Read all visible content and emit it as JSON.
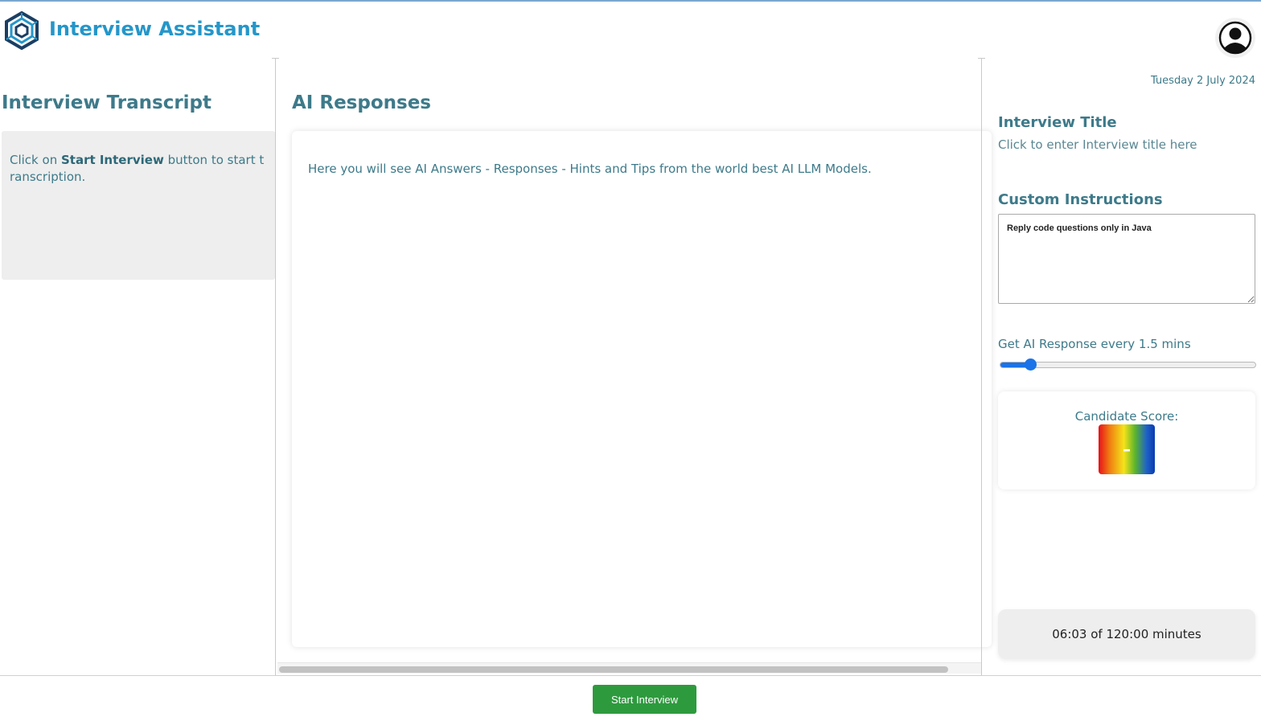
{
  "app": {
    "title": "Interview Assistant"
  },
  "transcript": {
    "heading": "Interview Transcript",
    "text_before": "Click on ",
    "text_bold": "Start Interview",
    "text_after": " button to start transcription."
  },
  "responses": {
    "heading": "AI Responses",
    "placeholder_text": "Here you will see AI Answers - Responses - Hints and Tips from the world best AI LLM Models."
  },
  "sidebar": {
    "date": "Tuesday 2 July 2024",
    "interview_title_heading": "Interview Title",
    "interview_title_placeholder": "Click to enter Interview title here",
    "custom_instructions_heading": "Custom Instructions",
    "custom_instructions_value": "Reply code questions only in Java",
    "slider_label": "Get AI Response every 1.5 mins",
    "slider_fraction": 0.12,
    "score_label": "Candidate Score:",
    "score_value": "–",
    "timer_text": "06:03 of 120:00 minutes"
  },
  "footer": {
    "start_button_label": "Start Interview"
  },
  "colors": {
    "brand": "#2596c9",
    "heading": "#3d7a8a",
    "start_button": "#2e9a3e",
    "slider": "#1a73e8"
  },
  "icons": {
    "logo": "hexagon-logo-icon",
    "avatar": "user-avatar-icon"
  }
}
